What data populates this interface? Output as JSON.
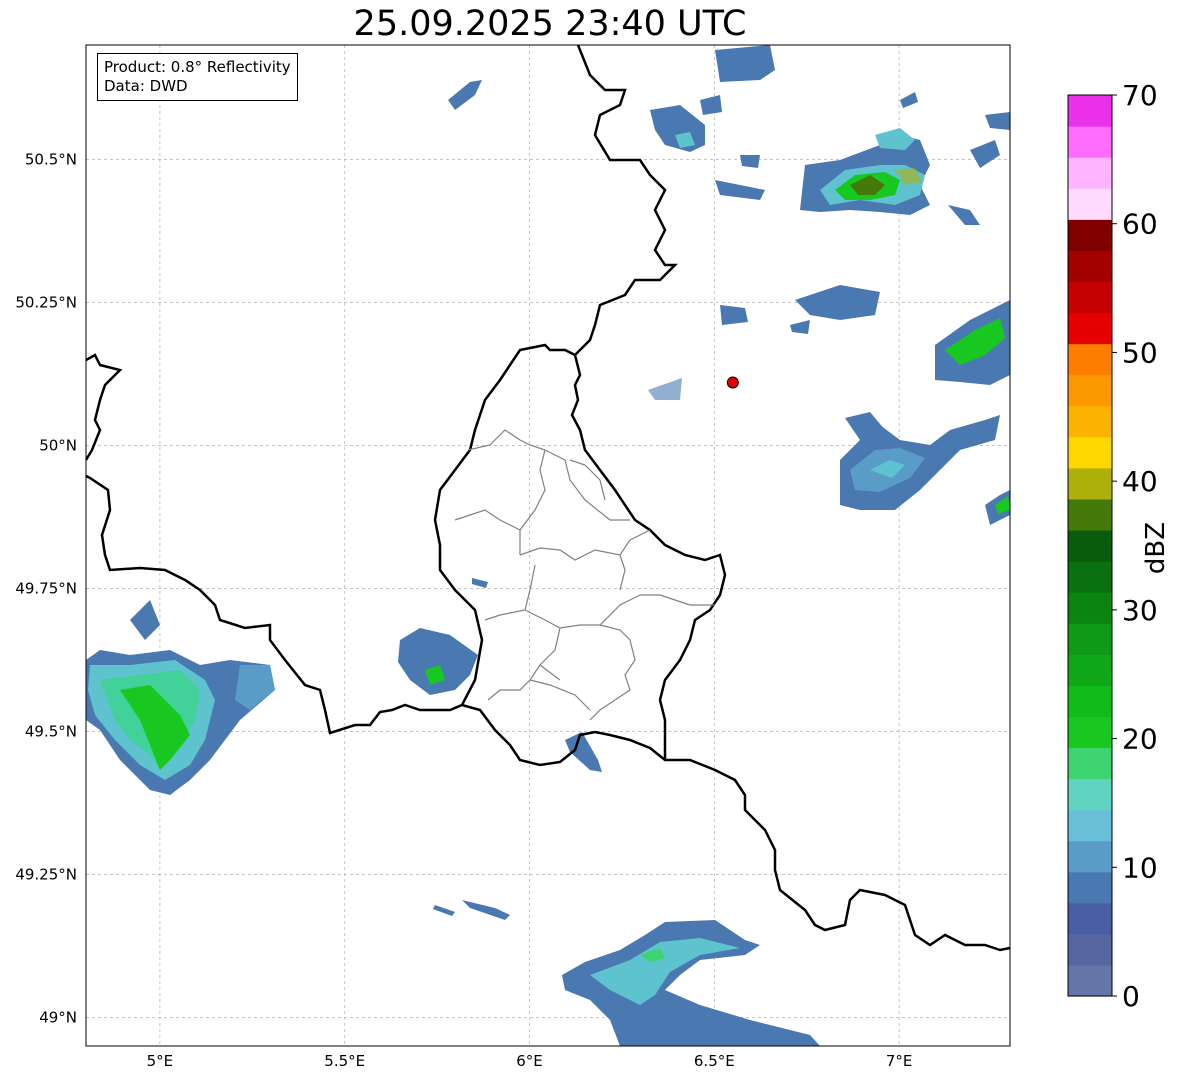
{
  "title": "25.09.2025 23:40 UTC",
  "info": {
    "product": "Product: 0.8° Reflectivity",
    "source": "Data: DWD"
  },
  "axes": {
    "lon_range": [
      4.8,
      7.3
    ],
    "lat_range": [
      48.95,
      50.7
    ],
    "lon_ticks": [
      {
        "v": 5.0,
        "label": "5°E"
      },
      {
        "v": 5.5,
        "label": "5.5°E"
      },
      {
        "v": 6.0,
        "label": "6°E"
      },
      {
        "v": 6.5,
        "label": "6.5°E"
      },
      {
        "v": 7.0,
        "label": "7°E"
      }
    ],
    "lat_ticks": [
      {
        "v": 50.5,
        "label": "50.5°N"
      },
      {
        "v": 50.25,
        "label": "50.25°N"
      },
      {
        "v": 50.0,
        "label": "50°N"
      },
      {
        "v": 49.75,
        "label": "49.75°N"
      },
      {
        "v": 49.5,
        "label": "49.5°N"
      },
      {
        "v": 49.25,
        "label": "49.25°N"
      },
      {
        "v": 49.0,
        "label": "49°N"
      }
    ]
  },
  "radar_site": {
    "lon": 6.55,
    "lat": 50.11,
    "color": "#e00000"
  },
  "colorbar": {
    "label": "dBZ",
    "min": 0,
    "max": 70,
    "ticks": [
      {
        "v": 0,
        "label": "0"
      },
      {
        "v": 10,
        "label": "10"
      },
      {
        "v": 20,
        "label": "20"
      },
      {
        "v": 30,
        "label": "30"
      },
      {
        "v": 40,
        "label": "40"
      },
      {
        "v": 50,
        "label": "50"
      },
      {
        "v": 60,
        "label": "60"
      },
      {
        "v": 70,
        "label": "70"
      }
    ],
    "colors": [
      "#6577a8",
      "#5566a0",
      "#4a5ea5",
      "#4a78b0",
      "#5a9cc8",
      "#68c0d8",
      "#60d4c0",
      "#3ed470",
      "#18c820",
      "#12bc18",
      "#10a818",
      "#0e9a16",
      "#0c8412",
      "#0a7010",
      "#085c0c",
      "#457a0a",
      "#adb00a",
      "#fed700",
      "#fcb300",
      "#fc9800",
      "#fc7e00",
      "#e40000",
      "#c40000",
      "#a40000",
      "#800000",
      "#ffdcff",
      "#ffb4ff",
      "#ff6cff",
      "#ea30ea"
    ]
  }
}
